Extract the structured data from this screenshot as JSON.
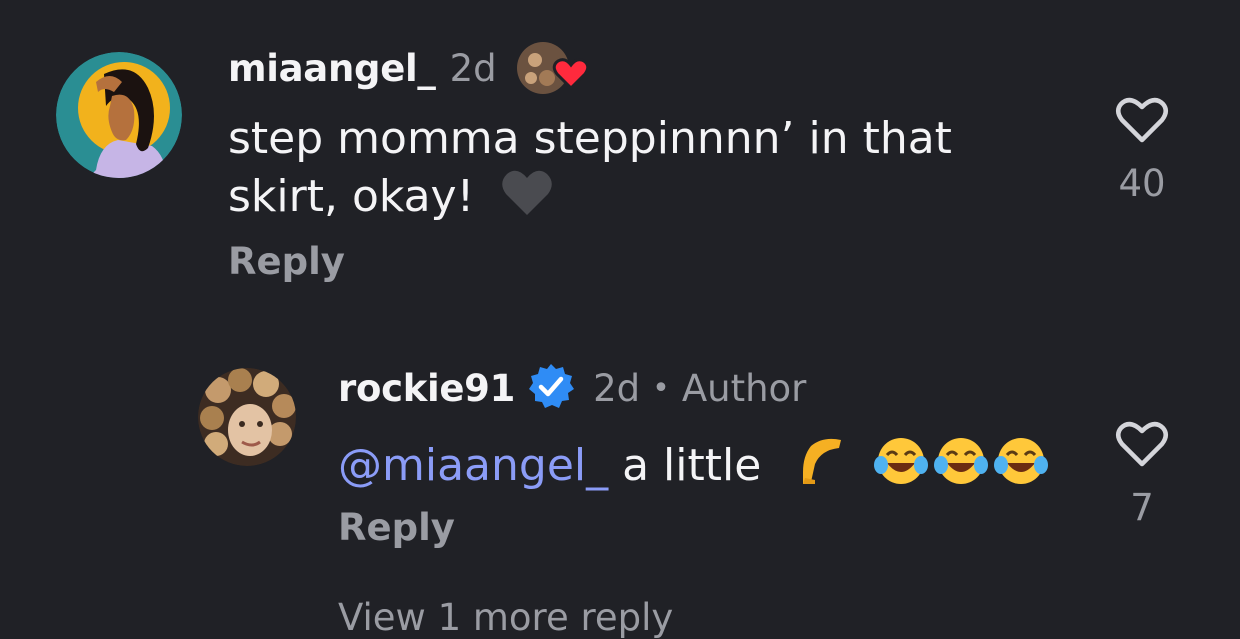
{
  "comments": [
    {
      "username": "miaangel_",
      "time": "2d",
      "text_line1": "step momma steppinnnn’ in that",
      "text_line2": "skirt, okay!",
      "reply_label": "Reply",
      "likes": "40"
    },
    {
      "username": "rockie91",
      "time": "2d",
      "separator": "•",
      "badge": "Author",
      "mention": "@miaangel_",
      "text": " a little ",
      "reply_label": "Reply",
      "likes": "7"
    }
  ],
  "view_more_label": "View 1 more reply",
  "icons": {
    "like": "heart-outline-icon",
    "verified": "verified-badge-icon",
    "author_liked": "author-liked-heart-icon",
    "mention": "threads-at-icon"
  },
  "colors": {
    "background": "#202126",
    "mention": "#8b9cf7",
    "verified": "#2f8cf5",
    "heart": "#ff2a3d"
  }
}
